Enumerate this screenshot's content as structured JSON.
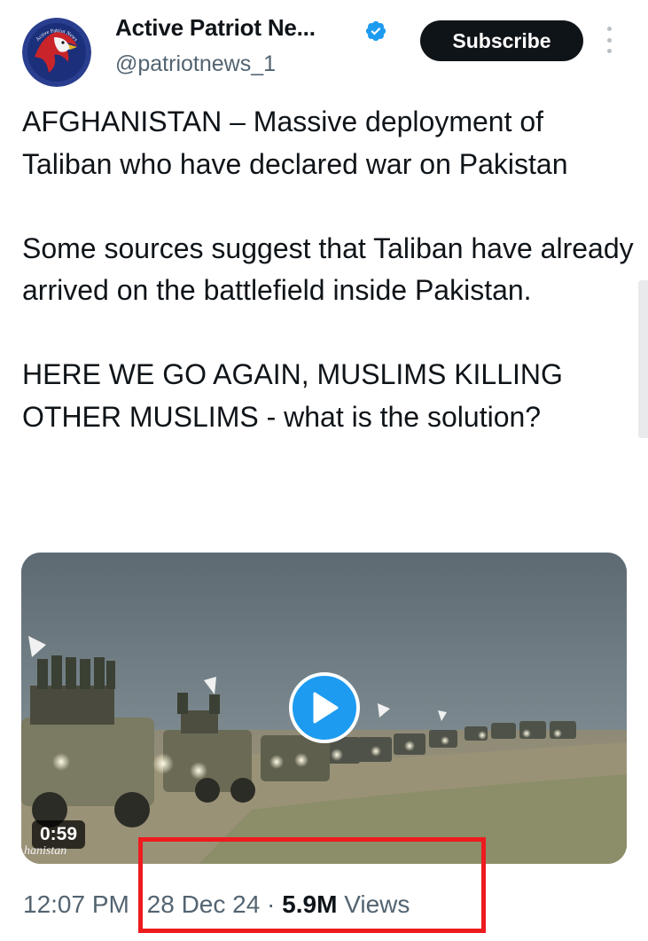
{
  "author": {
    "display_name": "Active Patriot Ne...",
    "handle": "@patriotnews_1",
    "avatar_icon": "eagle-logo-icon",
    "verified_icon": "verified-badge-icon",
    "avatar_text": "Active Patriot News"
  },
  "actions": {
    "subscribe_label": "Subscribe",
    "more_icon": "more-vertical-icon"
  },
  "tweet": {
    "paragraphs": [
      "AFGHANISTAN – Massive deployment of Taliban who have declared war on Pakistan",
      "Some sources suggest that Taliban have already arrived on the battlefield inside Pakistan.",
      "HERE WE GO AGAIN, MUSLIMS KILLING OTHER MUSLIMS - what is the solution?"
    ]
  },
  "media": {
    "type": "video",
    "duration": "0:59",
    "watermark": "hanistan",
    "play_icon": "play-icon"
  },
  "meta": {
    "time": "12:07 PM",
    "date": "28 Dec 24",
    "separator": " · ",
    "views_count": "5.9M",
    "views_label": "Views"
  },
  "colors": {
    "text_primary": "#0f1419",
    "text_secondary": "#536471",
    "accent_blue": "#1d9bf0",
    "highlight_red": "#ee1b1f"
  }
}
